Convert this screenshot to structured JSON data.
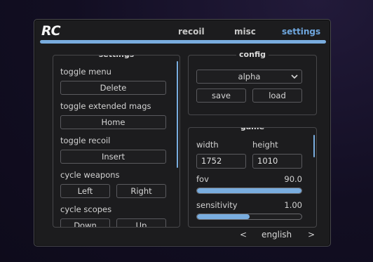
{
  "app": {
    "logo": "RC"
  },
  "tabs": [
    {
      "label": "recoil",
      "active": false
    },
    {
      "label": "misc",
      "active": false
    },
    {
      "label": "settings",
      "active": true
    }
  ],
  "colors": {
    "accent": "#79addf",
    "background": "#1c1c1e",
    "border": "#47474a"
  },
  "settings_panel": {
    "title": "settings",
    "items": [
      {
        "label": "toggle menu",
        "key": "Delete"
      },
      {
        "label": "toggle extended mags",
        "key": "Home"
      },
      {
        "label": "toggle recoil",
        "key": "Insert"
      },
      {
        "label": "cycle weapons",
        "left": "Left",
        "right": "Right"
      },
      {
        "label": "cycle scopes",
        "left": "Down",
        "right": "Up"
      }
    ]
  },
  "config_panel": {
    "title": "config",
    "selected": "alpha",
    "save_label": "save",
    "load_label": "load"
  },
  "game_panel": {
    "title": "game",
    "width_label": "width",
    "height_label": "height",
    "width_value": "1752",
    "height_value": "1010",
    "fov_label": "fov",
    "fov_value": "90.0",
    "fov_fill": 1.0,
    "sensitivity_label": "sensitivity",
    "sensitivity_value": "1.00",
    "sensitivity_fill": 0.5
  },
  "footer": {
    "prev": "<",
    "language": "english",
    "next": ">"
  }
}
